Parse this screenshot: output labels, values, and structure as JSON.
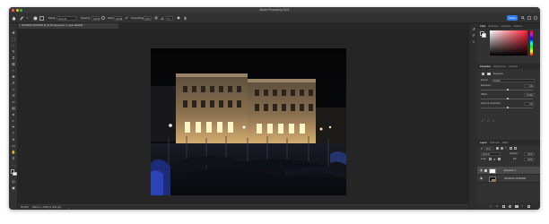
{
  "window": {
    "title": "Adobe Photoshop 2022",
    "traffic_lights": [
      "#fe5f57",
      "#febc2e",
      "#28c840"
    ]
  },
  "options_bar": {
    "tool_icon": "brush-icon",
    "mode_label": "Mode:",
    "mode_value": "Normal",
    "opacity_label": "Opacity:",
    "opacity_value": "100%",
    "flow_label": "Flow:",
    "flow_value": "100%",
    "smoothing_label": "Smoothing:",
    "smoothing_value": "10%",
    "angle_value": "0°",
    "share_label": "Share"
  },
  "document": {
    "tab_label": "20140611-P1060300 @ 30.2% (Exposure 1, Layer Mask/8) *"
  },
  "status_bar": {
    "zoom": "30.24%",
    "info": "4592 px x 3448 px (240 ppi)"
  },
  "panels": {
    "color": {
      "tabs": [
        "Color",
        "Swatches",
        "Gradients",
        "Patterns"
      ],
      "active_tab": "Color",
      "hue_strip": [
        "#ff0000",
        "#ff00ff",
        "#0000ff",
        "#00ffff",
        "#00ff00",
        "#ffff00",
        "#ff0000"
      ],
      "base_color": "#ff1e35"
    },
    "properties": {
      "tabs": [
        "Properties",
        "Adjustments",
        "Libraries"
      ],
      "active_tab": "Properties",
      "header": "Exposure",
      "preset_label": "Preset:",
      "preset_value": "Default",
      "rows": [
        {
          "label": "Exposure:",
          "value": "0.00",
          "level": 0.5
        },
        {
          "label": "Offset:",
          "value": "0.0000",
          "level": 0.5
        },
        {
          "label": "Gamma Correction:",
          "value": "1.00",
          "level": 0.5
        }
      ]
    },
    "layers": {
      "tabs": [
        "Layers",
        "Channels",
        "Paths"
      ],
      "active_tab": "Layers",
      "kind_label": "Kind",
      "blend_mode": "Normal",
      "opacity_label": "Opacity:",
      "opacity_value": "100%",
      "lock_label": "Lock:",
      "fill_label": "Fill:",
      "fill_value": "100%",
      "layers": [
        {
          "name": "Exposure 1",
          "selected": true
        },
        {
          "name": "20140611-P1060300",
          "selected": false
        }
      ]
    }
  }
}
